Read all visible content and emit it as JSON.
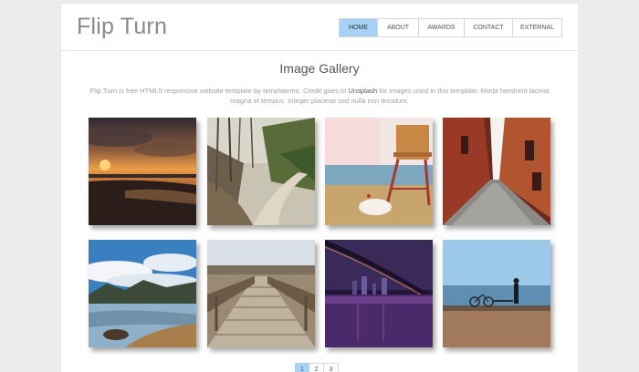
{
  "brand": "Flip Turn",
  "nav": {
    "items": [
      {
        "label": "HOME",
        "active": true
      },
      {
        "label": "ABOUT",
        "active": false
      },
      {
        "label": "AWARDS",
        "active": false
      },
      {
        "label": "CONTACT",
        "active": false
      },
      {
        "label": "EXTERNAL",
        "active": false
      }
    ]
  },
  "main": {
    "title": "Image Gallery",
    "desc_before": "Flip Turn is free HTML5 responsive website template by templatemo. Credit goes to ",
    "desc_link": "Unsplash",
    "desc_after": " for images used in this template. Morbi hendrerit lacinia magna et tempus. Integer placerat sed nulla non tincidunt."
  },
  "pagination": {
    "pages": [
      "1",
      "2",
      "3"
    ],
    "current": "1"
  },
  "colors": {
    "accent": "#a5d2f5",
    "brand_text": "#8a8a8a"
  }
}
